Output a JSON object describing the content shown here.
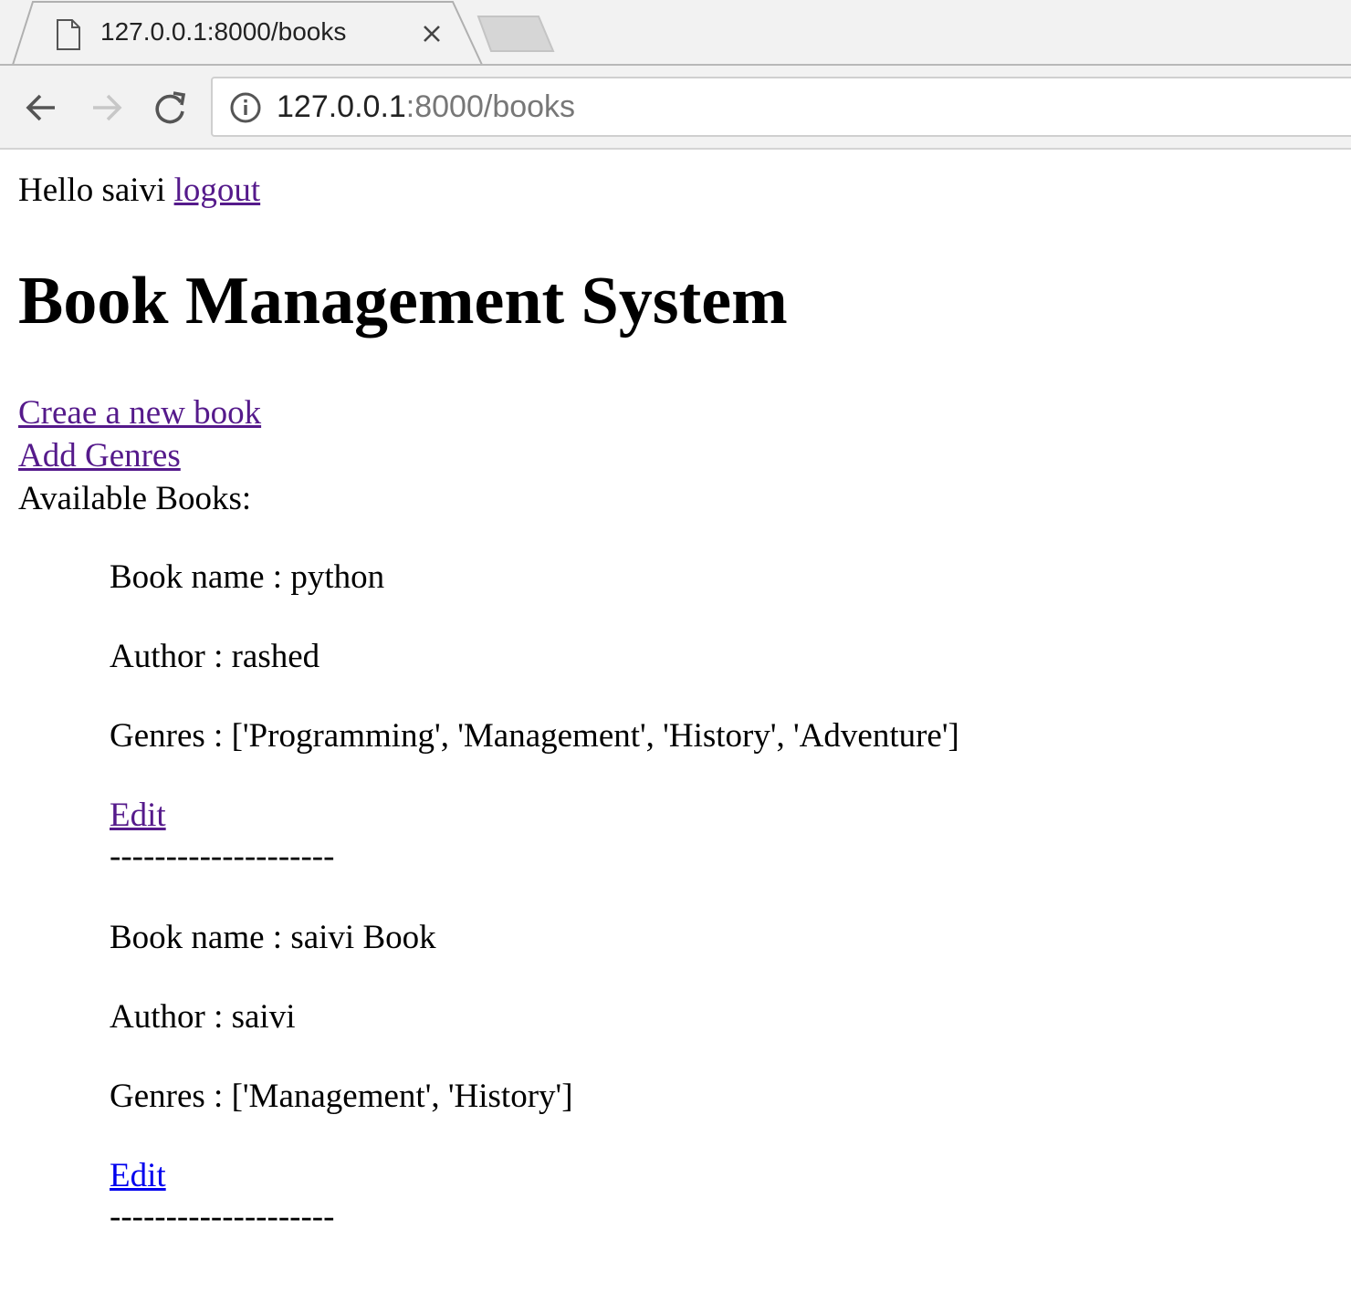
{
  "browser": {
    "tab_title": "127.0.0.1:8000/books",
    "url_host": "127.0.0.1",
    "url_rest": ":8000/books"
  },
  "page": {
    "greeting": "Hello saivi",
    "logout_label": "logout",
    "title": "Book Management System",
    "create_link": "Creae a new book",
    "add_genres_link": "Add Genres",
    "available_label": "Available Books:",
    "books": [
      {
        "name": "Book name : python",
        "author": "Author : rashed",
        "genres": "Genres : ['Programming', 'Management', 'History', 'Adventure']",
        "edit": "Edit",
        "separator": "--------------------"
      },
      {
        "name": "Book name : saivi Book",
        "author": "Author : saivi",
        "genres": "Genres : ['Management', 'History']",
        "edit": "Edit",
        "separator": "--------------------"
      }
    ]
  },
  "colors": {
    "link_visited": "#551a8b",
    "link_unvisited": "#0000ee"
  }
}
